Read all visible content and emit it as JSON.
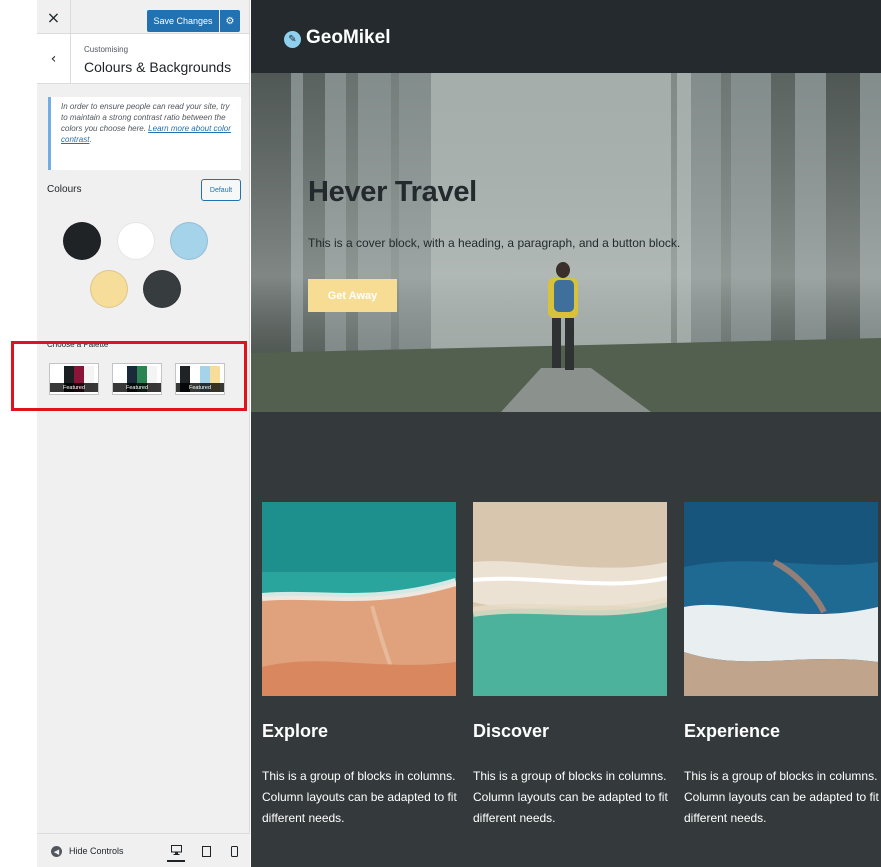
{
  "customizer": {
    "close_label": "×",
    "save_label": "Save Changes",
    "gear_label": "⚙",
    "back_label": "‹",
    "breadcrumb": "Customising",
    "section_title": "Colours & Backgrounds",
    "notice_text": "In order to ensure people can read your site, try to maintain a strong contrast ratio between the colors you choose here. ",
    "notice_link": "Learn more about color contrast",
    "notice_end": ".",
    "colours_label": "Colours",
    "default_label": "Default",
    "swatches": [
      {
        "name": "black",
        "color": "#1f2326"
      },
      {
        "name": "white",
        "color": "#ffffff"
      },
      {
        "name": "light-blue",
        "color": "#a4d3ea"
      },
      {
        "name": "yellow",
        "color": "#f6dd99"
      },
      {
        "name": "dark-grey",
        "color": "#373c3f"
      }
    ],
    "palette_label": "Choose a Palette",
    "palettes": [
      {
        "badge": "Featured",
        "colors": [
          "#ffffff",
          "#1c1f22",
          "#8a1538",
          "#f4f4f4"
        ]
      },
      {
        "badge": "Featured",
        "colors": [
          "#ffffff",
          "#1b2a3a",
          "#2a8451",
          "#f4f4f4"
        ]
      },
      {
        "badge": "Featured",
        "colors": [
          "#1f2326",
          "#ffffff",
          "#a4d3ea",
          "#f6dd99"
        ]
      }
    ],
    "hide_controls_label": "Hide Controls"
  },
  "preview": {
    "site_title": "GeoMikel",
    "hero": {
      "title": "Hever Travel",
      "text": "This is a cover block, with a heading, a paragraph, and a button block.",
      "button": "Get Away"
    },
    "columns": [
      {
        "title": "Explore",
        "text": "This is a group of blocks in columns. Column layouts can be adapted to fit different needs."
      },
      {
        "title": "Discover",
        "text": "This is a group of blocks in columns. Column layouts can be adapted to fit different needs."
      },
      {
        "title": "Experience",
        "text": "This is a group of blocks in columns. Column layouts can be adapted to fit different needs."
      }
    ]
  }
}
